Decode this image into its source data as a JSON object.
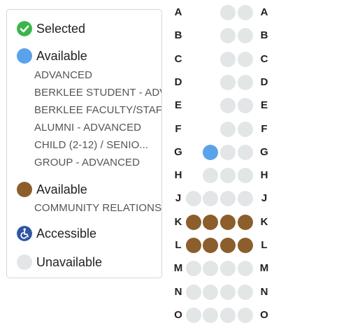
{
  "legend": {
    "selected": {
      "label": "Selected",
      "icon": "check-circle-icon",
      "color": "#3bb54a"
    },
    "available_primary": {
      "label": "Available",
      "icon": "blue-dot-icon",
      "color": "#5aa3ea",
      "price_types": [
        "ADVANCED",
        "BERKLEE STUDENT - ADVANCED",
        "BERKLEE FACULTY/STAFF - ADVANCED",
        "ALUMNI - ADVANCED",
        "CHILD (2-12) / SENIO...",
        "GROUP - ADVANCED"
      ]
    },
    "available_secondary": {
      "label": "Available",
      "icon": "brown-dot-icon",
      "color": "#8b5e2b",
      "price_types": [
        "COMMUNITY RELATIONS"
      ]
    },
    "accessible": {
      "label": "Accessible",
      "icon": "wheelchair-icon",
      "color": "#2f55a4"
    },
    "unavailable": {
      "label": "Unavailable",
      "icon": "gray-dot-icon",
      "color": "#e2e6e6"
    }
  },
  "seat_map": {
    "rows": [
      {
        "label": "A",
        "seats": [
          "unavailable",
          "unavailable"
        ]
      },
      {
        "label": "B",
        "seats": [
          "unavailable",
          "unavailable"
        ]
      },
      {
        "label": "C",
        "seats": [
          "unavailable",
          "unavailable"
        ]
      },
      {
        "label": "D",
        "seats": [
          "unavailable",
          "unavailable"
        ]
      },
      {
        "label": "E",
        "seats": [
          "unavailable",
          "unavailable"
        ]
      },
      {
        "label": "F",
        "seats": [
          "unavailable",
          "unavailable"
        ]
      },
      {
        "label": "G",
        "seats": [
          "available_primary",
          "unavailable",
          "unavailable"
        ]
      },
      {
        "label": "H",
        "seats": [
          "unavailable",
          "unavailable",
          "unavailable"
        ]
      },
      {
        "label": "J",
        "seats": [
          "unavailable",
          "unavailable",
          "unavailable",
          "unavailable"
        ]
      },
      {
        "label": "K",
        "seats": [
          "available_secondary",
          "available_secondary",
          "available_secondary",
          "available_secondary"
        ]
      },
      {
        "label": "L",
        "seats": [
          "available_secondary",
          "available_secondary",
          "available_secondary",
          "available_secondary"
        ]
      },
      {
        "label": "M",
        "seats": [
          "unavailable",
          "unavailable",
          "unavailable",
          "unavailable"
        ]
      },
      {
        "label": "N",
        "seats": [
          "unavailable",
          "unavailable",
          "unavailable",
          "unavailable"
        ]
      },
      {
        "label": "O",
        "seats": [
          "unavailable",
          "unavailable",
          "unavailable",
          "unavailable"
        ]
      }
    ]
  }
}
